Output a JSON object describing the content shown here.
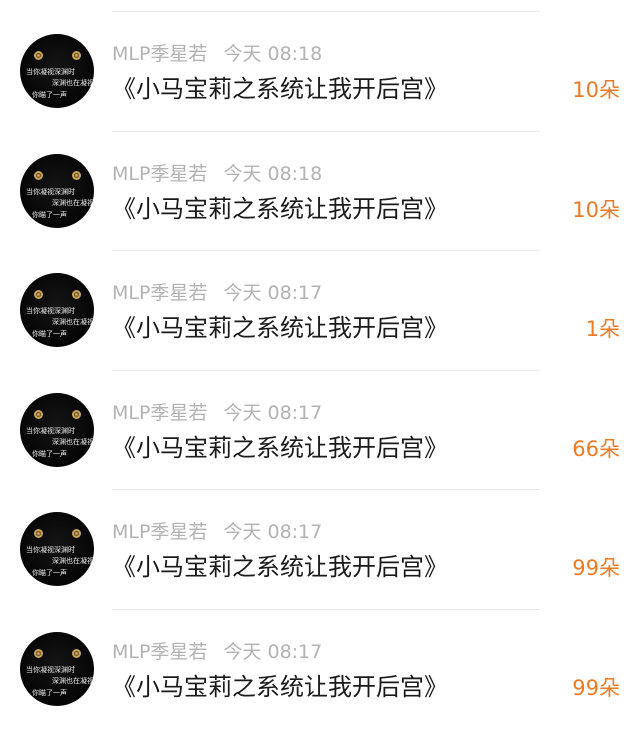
{
  "accent_color": "#f07a22",
  "avatar_caption": {
    "line1": "当你凝视深渊时",
    "line2": "深渊也在凝视你",
    "line3": "你瞄了一声"
  },
  "items": [
    {
      "username": "MLP季星若",
      "time": "今天 08:18",
      "title": "《小马宝莉之系统让我开后宫》",
      "count": "10朵"
    },
    {
      "username": "MLP季星若",
      "time": "今天 08:18",
      "title": "《小马宝莉之系统让我开后宫》",
      "count": "10朵"
    },
    {
      "username": "MLP季星若",
      "time": "今天 08:17",
      "title": "《小马宝莉之系统让我开后宫》",
      "count": "1朵"
    },
    {
      "username": "MLP季星若",
      "time": "今天 08:17",
      "title": "《小马宝莉之系统让我开后宫》",
      "count": "66朵"
    },
    {
      "username": "MLP季星若",
      "time": "今天 08:17",
      "title": "《小马宝莉之系统让我开后宫》",
      "count": "99朵"
    },
    {
      "username": "MLP季星若",
      "time": "今天 08:17",
      "title": "《小马宝莉之系统让我开后宫》",
      "count": "99朵"
    }
  ]
}
